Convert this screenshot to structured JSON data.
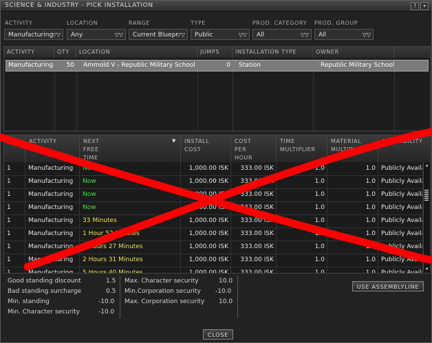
{
  "window": {
    "title": "SCIENCE & INDUSTRY - PICK INSTALLATION",
    "buttons": [
      "?",
      "▾"
    ]
  },
  "filters": [
    {
      "label": "ACTIVITY",
      "value": "Manufacturing"
    },
    {
      "label": "LOCATION",
      "value": "Any"
    },
    {
      "label": "RANGE",
      "value": "Current Bluepr"
    },
    {
      "label": "TYPE",
      "value": "Public"
    },
    {
      "label": "PROD. CATEGORY",
      "value": "All"
    },
    {
      "label": "PROD. GROUP",
      "value": "All"
    }
  ],
  "installations": {
    "columns": [
      "ACTIVITY",
      "QTY",
      "LOCATION",
      "JUMPS",
      "INSTALLATION TYPE",
      "OWNER"
    ],
    "rows": [
      {
        "activity": "Manufacturing",
        "qty": "50",
        "location": "Ammold V - Republic Military School",
        "jumps": "0",
        "type": "Station",
        "owner": "Republic Military School"
      }
    ]
  },
  "lines": {
    "columns": [
      "",
      "ACTIVITY",
      "NEXT\nFREE\nTIME",
      "INSTALL\nCOST",
      "COST\nPER\nHOUR",
      "TIME\nMULTIPLIER",
      "MATERIAL\nMULTIPLIER",
      "AVAILABILITY"
    ],
    "sort_icon": "▼",
    "rows": [
      {
        "n": "1",
        "activity": "Manufacturing",
        "free": "Now",
        "install": "1,000.00 ISK",
        "hour": "333.00 ISK",
        "tm": "1.0",
        "mm": "1.0",
        "avail": "Publicly Available"
      },
      {
        "n": "1",
        "activity": "Manufacturing",
        "free": "Now",
        "install": "1,000.00 ISK",
        "hour": "333.00 ISK",
        "tm": "1.0",
        "mm": "1.0",
        "avail": "Publicly Available"
      },
      {
        "n": "1",
        "activity": "Manufacturing",
        "free": "Now",
        "install": "1,000.00 ISK",
        "hour": "333.00 ISK",
        "tm": "1.0",
        "mm": "1.0",
        "avail": "Publicly Available"
      },
      {
        "n": "1",
        "activity": "Manufacturing",
        "free": "Now",
        "install": "1,000.00 ISK",
        "hour": "333.00 ISK",
        "tm": "1.0",
        "mm": "1.0",
        "avail": "Publicly Available"
      },
      {
        "n": "1",
        "activity": "Manufacturing",
        "free": "33 Minutes",
        "install": "1,000.00 ISK",
        "hour": "333.00 ISK",
        "tm": "1.0",
        "mm": "1.0",
        "avail": "Publicly Available"
      },
      {
        "n": "1",
        "activity": "Manufacturing",
        "free": "1 Hour 52 Minutes",
        "install": "1,000.00 ISK",
        "hour": "333.00 ISK",
        "tm": "1.0",
        "mm": "1.0",
        "avail": "Publicly Available"
      },
      {
        "n": "1",
        "activity": "Manufacturing",
        "free": "2 Hours 27 Minutes",
        "install": "1,000.00 ISK",
        "hour": "333.00 ISK",
        "tm": "1.0",
        "mm": "1.0",
        "avail": "Publicly Available"
      },
      {
        "n": "1",
        "activity": "Manufacturing",
        "free": "2 Hours 31 Minutes",
        "install": "1,000.00 ISK",
        "hour": "333.00 ISK",
        "tm": "1.0",
        "mm": "1.0",
        "avail": "Publicly Available"
      },
      {
        "n": "1",
        "activity": "Manufacturing",
        "free": "5 Hours 40 Minutes",
        "install": "1,000.00 ISK",
        "hour": "333.00 ISK",
        "tm": "1.0",
        "mm": "1.0",
        "avail": "Publicly Available"
      }
    ]
  },
  "standings": {
    "left": [
      {
        "label": "Good standing discount",
        "value": "1.5"
      },
      {
        "label": "Bad standing surcharge",
        "value": "0.5"
      },
      {
        "label": "Min. standing",
        "value": "-10.0"
      },
      {
        "label": "Min. Character security",
        "value": "-10.0"
      }
    ],
    "right": [
      {
        "label": "Max. Character security",
        "value": "10.0"
      },
      {
        "label": "Min.Corporation security",
        "value": "-10.0"
      },
      {
        "label": "Max. Corporation security",
        "value": "10.0"
      }
    ]
  },
  "actions": {
    "use_assembly": "USE ASSEMBLYLINE",
    "close": "CLOSE"
  },
  "colors": {
    "now": "#3fe03f",
    "time": "#f0e04a",
    "overlay_x": "#ff0000"
  }
}
